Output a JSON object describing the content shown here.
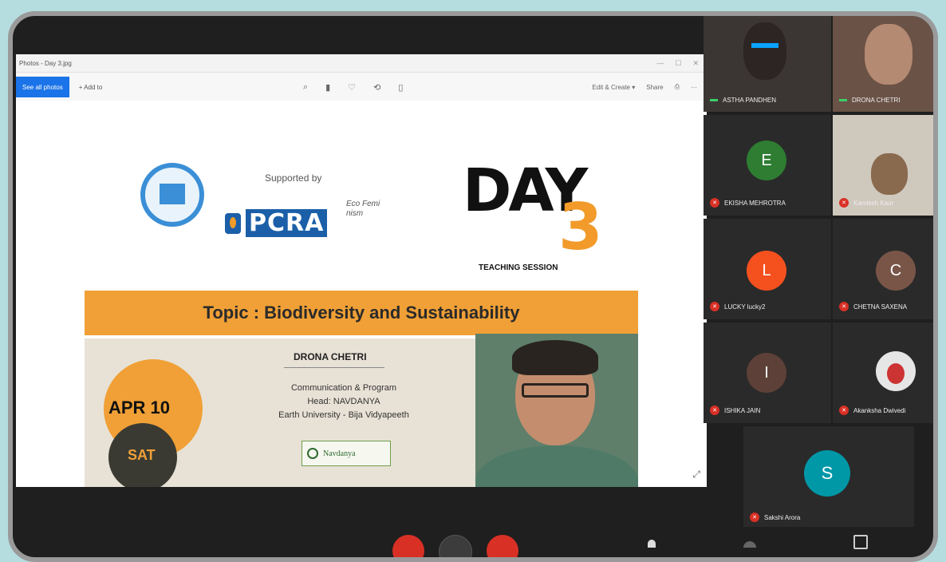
{
  "window": {
    "title": "Photos - Day 3.jpg",
    "controls": [
      "—",
      "☐",
      "✕"
    ]
  },
  "toolbar": {
    "see_all_photos": "See all photos",
    "add_to": "+ Add to",
    "center_icons": [
      "⌕",
      "▮",
      "♡",
      "⟲",
      "▯"
    ],
    "edit_create": "Edit & Create ▾",
    "share": "Share",
    "print_icon": "⎙",
    "more": "···"
  },
  "slide": {
    "supported_by": "Supported by",
    "pcra": "PCRA",
    "eco_text": "Eco Femi nism",
    "day": "DAY",
    "day_number": "3",
    "teaching_session": "TEACHING SESSION",
    "topic": "Topic : Biodiversity and Sustainability",
    "date": "APR 10",
    "weekday": "SAT",
    "speaker_name": "DRONA CHETRI",
    "speaker_line1": "Communication & Program",
    "speaker_line2": "Head: NAVDANYA",
    "speaker_line3": "Earth University - Bija Vidyapeeth",
    "navdanya": "Navdanya",
    "resize_icon": "⤢"
  },
  "participants": [
    {
      "name": "ASTHA PANDHEN",
      "initial": "",
      "color": "",
      "muted": false
    },
    {
      "name": "DRONA CHETRI",
      "initial": "",
      "color": "",
      "muted": false
    },
    {
      "name": "EKISHA MEHROTRA",
      "initial": "E",
      "color": "#2e7d32",
      "muted": true
    },
    {
      "name": "Kamlesh Kaur",
      "initial": "",
      "color": "",
      "muted": true
    },
    {
      "name": "LUCKY lucky2",
      "initial": "L",
      "color": "#f4511e",
      "muted": true
    },
    {
      "name": "CHETNA SAXENA",
      "initial": "C",
      "color": "#795548",
      "muted": true
    },
    {
      "name": "ISHIKA JAIN",
      "initial": "I",
      "color": "#5d4037",
      "muted": true
    },
    {
      "name": "Akanksha Dwivedi",
      "initial": "",
      "color": "",
      "muted": true
    },
    {
      "name": "Sakshi Arora",
      "initial": "S",
      "color": "#0097a7",
      "muted": true
    }
  ],
  "colors": {
    "accent_orange": "#f0a036",
    "mic_off": "#d93025",
    "bg": "#b5dde0"
  }
}
